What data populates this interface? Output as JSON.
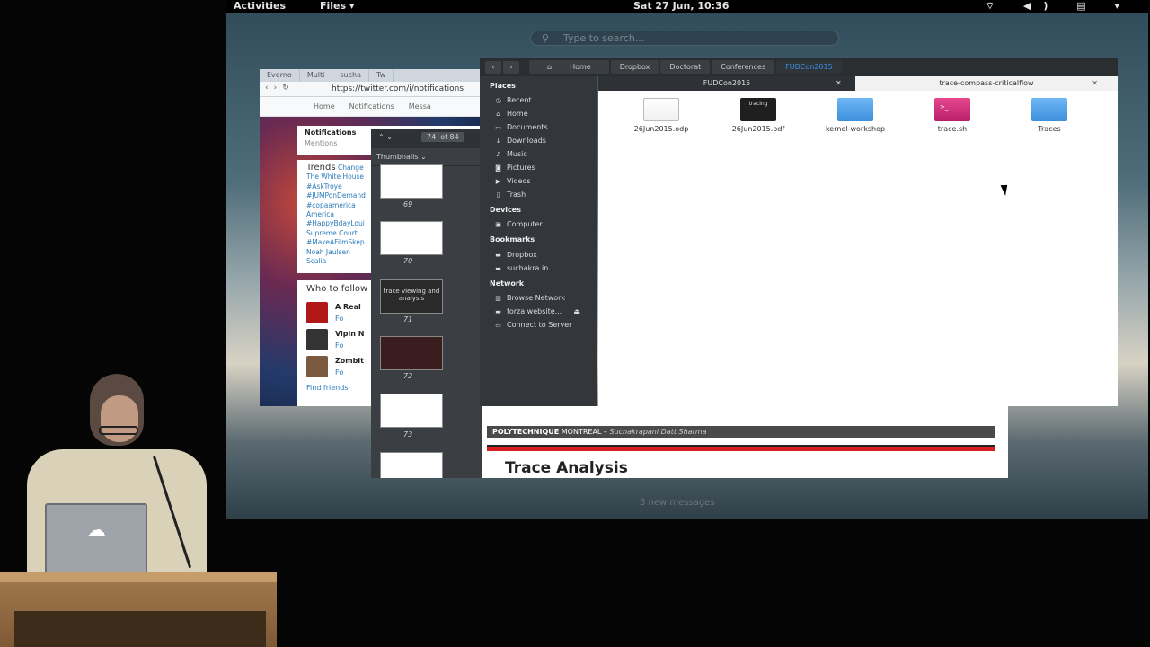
{
  "topbar": {
    "activities": "Activities",
    "app_menu": "Files ▾",
    "clock": "Sat 27 Jun, 10:36",
    "tray": "⌔ ◀) ▤ ▾"
  },
  "overview": {
    "search_placeholder": "Type to search...",
    "new_messages": "3 new messages"
  },
  "browser": {
    "tabs": [
      "Everno",
      "Multi",
      "sucha",
      "Tw"
    ],
    "url": "https://twitter.com/i/notifications",
    "nav_items": [
      "Home",
      "Notifications",
      "Messa"
    ],
    "notifications_title": "Notifications",
    "mentions": "Mentions",
    "trends_title": "Trends",
    "trends_change": "Change",
    "trends": [
      "The White House",
      "#AskTroye",
      "#JUMPonDemand",
      "#copaamerica",
      "America",
      "#HappyBdayLoui",
      "Supreme Court",
      "#MakeAFilmSkep",
      "Noah Jaulsen",
      "Scalia"
    ],
    "who_to_follow": "Who to follow",
    "follow": [
      {
        "name": "A Real",
        "action": "Fo"
      },
      {
        "name": "Vipin N",
        "action": "Fo"
      },
      {
        "name": "Zombit",
        "action": "Fo"
      }
    ],
    "find_friends": "Find friends"
  },
  "pdf": {
    "page_current": "74",
    "page_of": "of 84",
    "thumbnails_label": "Thumbnails",
    "thumbs": [
      {
        "num": "69",
        "kind": "light"
      },
      {
        "num": "70",
        "kind": "light"
      },
      {
        "num": "71",
        "kind": "dark",
        "text": "trace viewing and analysis"
      },
      {
        "num": "72",
        "kind": "red"
      },
      {
        "num": "73",
        "kind": "light"
      }
    ]
  },
  "files": {
    "breadcrumbs": [
      "Home",
      "Dropbox",
      "Doctorat",
      "Conferences",
      "FUDCon2015"
    ],
    "active_crumb": "FUDCon2015",
    "tabs": [
      "FUDCon2015",
      "trace-compass-criticalflow"
    ],
    "places_title": "Places",
    "places": [
      "Recent",
      "Home",
      "Documents",
      "Downloads",
      "Music",
      "Pictures",
      "Videos",
      "Trash"
    ],
    "devices_title": "Devices",
    "devices": [
      "Computer"
    ],
    "bookmarks_title": "Bookmarks",
    "bookmarks": [
      "Dropbox",
      "suchakra.in"
    ],
    "network_title": "Network",
    "network": [
      "Browse Network",
      "forza.website...",
      "Connect to Server"
    ],
    "items": [
      {
        "name": "26Jun2015.odp",
        "type": "doc"
      },
      {
        "name": "26Jun2015.pdf",
        "type": "pdf",
        "thumb_text": "tracing"
      },
      {
        "name": "kernel-workshop",
        "type": "folder"
      },
      {
        "name": "trace.sh",
        "type": "script",
        "thumb_text": ">_"
      },
      {
        "name": "Traces",
        "type": "folder"
      }
    ]
  },
  "slide": {
    "institution_bold": "POLYTECHNIQUE",
    "institution_rest": " MONTREAL – ",
    "author": "Suchakrapani Datt Sharma",
    "title": "Trace Analysis"
  },
  "presenter": {
    "laptop_logo": "☁"
  }
}
